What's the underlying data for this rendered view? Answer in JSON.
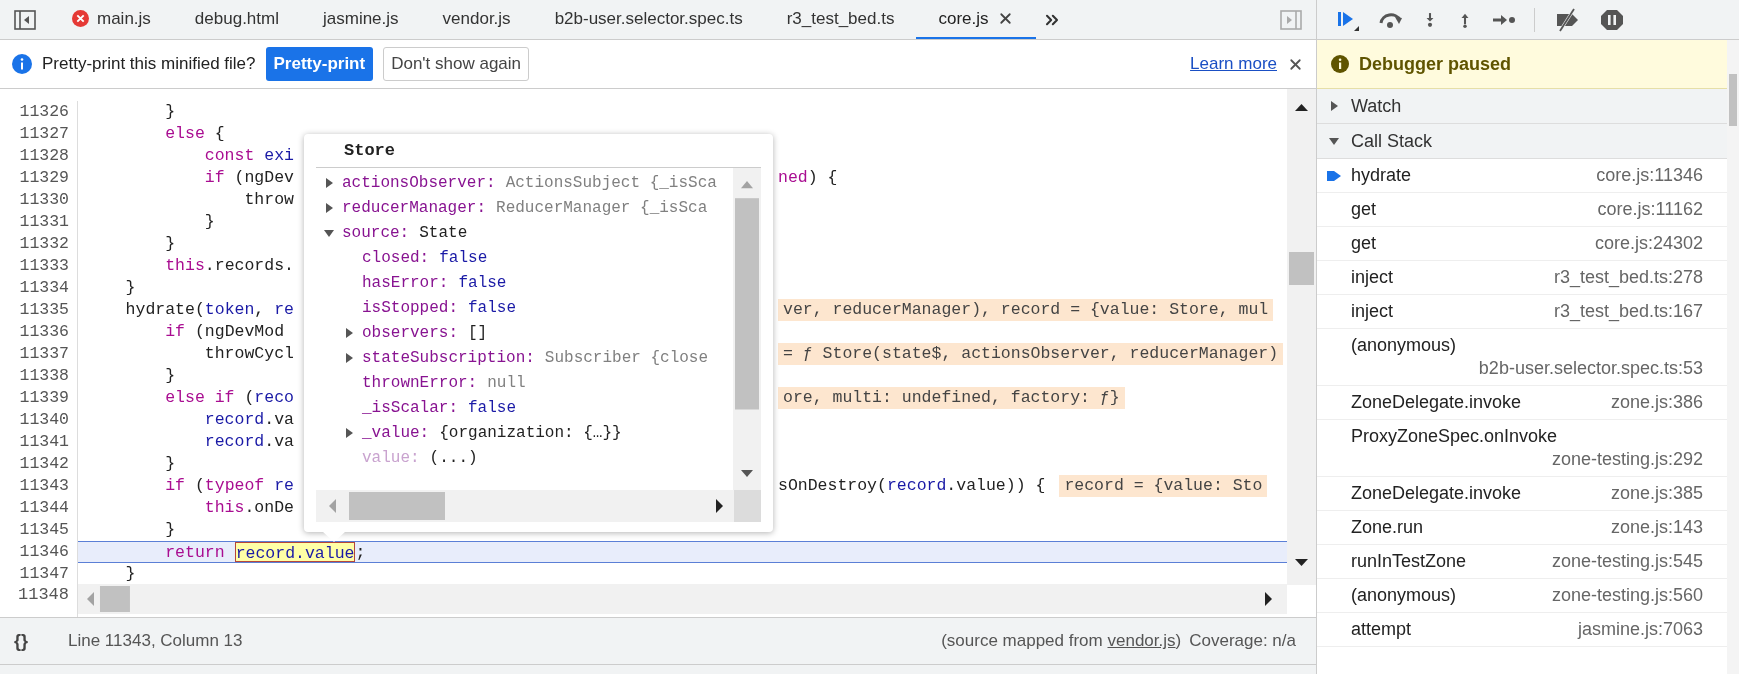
{
  "tabs": [
    {
      "label": "main.js",
      "selected": false,
      "error": true
    },
    {
      "label": "debug.html",
      "selected": false,
      "error": false
    },
    {
      "label": "jasmine.js",
      "selected": false,
      "error": false
    },
    {
      "label": "vendor.js",
      "selected": false,
      "error": false
    },
    {
      "label": "b2b-user.selector.spec.ts",
      "selected": false,
      "error": false
    },
    {
      "label": "r3_test_bed.ts",
      "selected": false,
      "error": false
    },
    {
      "label": "core.js",
      "selected": true,
      "error": false
    }
  ],
  "infobar": {
    "message": "Pretty-print this minified file?",
    "primary_button": "Pretty-print",
    "secondary_button": "Don't show again",
    "link": "Learn more"
  },
  "code": {
    "lines": [
      {
        "number": "11326",
        "current": false,
        "left": [
          {
            "kind": "plain",
            "text": "        }"
          }
        ]
      },
      {
        "number": "11327",
        "current": false,
        "left": [
          {
            "kind": "keyword",
            "text": "        else"
          },
          {
            "kind": "plain",
            "text": " {"
          }
        ]
      },
      {
        "number": "11328",
        "current": false,
        "left": [
          {
            "kind": "keyword",
            "text": "            const"
          },
          {
            "kind": "variable",
            "text": " exi"
          }
        ]
      },
      {
        "number": "11329",
        "current": false,
        "left": [
          {
            "kind": "keyword",
            "text": "            if"
          },
          {
            "kind": "plain",
            "text": " (ngDev"
          }
        ],
        "right": [
          {
            "kind": "keyword",
            "text": "ned"
          },
          {
            "kind": "plain",
            "text": ") {"
          }
        ]
      },
      {
        "number": "11330",
        "current": false,
        "left": [
          {
            "kind": "plain",
            "text": "                throw"
          }
        ]
      },
      {
        "number": "11331",
        "current": false,
        "left": [
          {
            "kind": "plain",
            "text": "            }"
          }
        ]
      },
      {
        "number": "11332",
        "current": false,
        "left": [
          {
            "kind": "plain",
            "text": "        }"
          }
        ]
      },
      {
        "number": "11333",
        "current": false,
        "left": [
          {
            "kind": "keyword",
            "text": "        this"
          },
          {
            "kind": "plain",
            "text": ".records."
          }
        ]
      },
      {
        "number": "11334",
        "current": false,
        "left": [
          {
            "kind": "plain",
            "text": "    }"
          }
        ]
      },
      {
        "number": "11335",
        "current": false,
        "left": [
          {
            "kind": "plain",
            "text": "    hydrate("
          },
          {
            "kind": "variable",
            "text": "token"
          },
          {
            "kind": "plain",
            "text": ", "
          },
          {
            "kind": "variable",
            "text": "re"
          }
        ],
        "right": [
          {
            "kind": "annotation",
            "text": "ver, reducerManager), record = {value: Store, mul"
          }
        ]
      },
      {
        "number": "11336",
        "current": false,
        "left": [
          {
            "kind": "keyword",
            "text": "        if"
          },
          {
            "kind": "plain",
            "text": " (ngDevMod"
          }
        ]
      },
      {
        "number": "11337",
        "current": false,
        "left": [
          {
            "kind": "plain",
            "text": "            throwCycl"
          }
        ],
        "right": [
          {
            "kind": "annotation",
            "text": "= ƒ Store(state$, actionsObserver, reducerManager)"
          }
        ]
      },
      {
        "number": "11338",
        "current": false,
        "left": [
          {
            "kind": "plain",
            "text": "        }"
          }
        ]
      },
      {
        "number": "11339",
        "current": false,
        "left": [
          {
            "kind": "keyword",
            "text": "        else if"
          },
          {
            "kind": "plain",
            "text": " ("
          },
          {
            "kind": "variable",
            "text": "reco"
          }
        ],
        "right": [
          {
            "kind": "annotation",
            "text": "ore, multi: undefined, factory: ƒ}"
          }
        ]
      },
      {
        "number": "11340",
        "current": false,
        "left": [
          {
            "kind": "variable",
            "text": "            record"
          },
          {
            "kind": "plain",
            "text": ".va"
          }
        ]
      },
      {
        "number": "11341",
        "current": false,
        "left": [
          {
            "kind": "variable",
            "text": "            record"
          },
          {
            "kind": "plain",
            "text": ".va"
          }
        ]
      },
      {
        "number": "11342",
        "current": false,
        "left": [
          {
            "kind": "plain",
            "text": "        }"
          }
        ]
      },
      {
        "number": "11343",
        "current": false,
        "left": [
          {
            "kind": "keyword",
            "text": "        if"
          },
          {
            "kind": "plain",
            "text": " ("
          },
          {
            "kind": "keyword",
            "text": "typeof"
          },
          {
            "kind": "variable",
            "text": " re"
          }
        ],
        "right": [
          {
            "kind": "plain",
            "text": "sOnDestroy("
          },
          {
            "kind": "variable",
            "text": "record"
          },
          {
            "kind": "plain",
            "text": ".value)) {"
          },
          {
            "kind": "annotation",
            "text": "record = {value: Sto"
          }
        ]
      },
      {
        "number": "11344",
        "current": false,
        "left": [
          {
            "kind": "keyword",
            "text": "            this"
          },
          {
            "kind": "plain",
            "text": ".onDe"
          }
        ]
      },
      {
        "number": "11345",
        "current": false,
        "left": [
          {
            "kind": "plain",
            "text": "        }"
          }
        ]
      },
      {
        "number": "11346",
        "current": true,
        "left": [
          {
            "kind": "keyword",
            "text": "        return"
          },
          {
            "kind": "highlight",
            "text": "record.value"
          },
          {
            "kind": "plain",
            "text": ";"
          }
        ]
      },
      {
        "number": "11347",
        "current": false,
        "left": [
          {
            "kind": "plain",
            "text": "    }"
          }
        ]
      }
    ],
    "last_number": "11348"
  },
  "popover": {
    "title": "Store",
    "properties": [
      {
        "name": "actionsObserver:",
        "value": "ActionsSubject {_isSca",
        "kind": "class",
        "expanded": false,
        "faded": false
      },
      {
        "name": "reducerManager:",
        "value": "ReducerManager {_isSca",
        "kind": "class",
        "expanded": false,
        "faded": false
      },
      {
        "name": "source:",
        "value": "State",
        "kind": "plain",
        "expanded": true,
        "faded": false,
        "children": [
          {
            "name": "closed:",
            "value": "false",
            "kind": "bool",
            "faded": false
          },
          {
            "name": "hasError:",
            "value": "false",
            "kind": "bool",
            "faded": false
          },
          {
            "name": "isStopped:",
            "value": "false",
            "kind": "bool",
            "faded": false
          },
          {
            "name": "observers:",
            "value": "[]",
            "kind": "plain",
            "expanded": false,
            "faded": false
          },
          {
            "name": "stateSubscription:",
            "value": "Subscriber {close",
            "kind": "class",
            "expanded": false,
            "faded": false
          },
          {
            "name": "thrownError:",
            "value": "null",
            "kind": "null",
            "faded": false
          },
          {
            "name": "_isScalar:",
            "value": "false",
            "kind": "bool",
            "faded": false
          },
          {
            "name": "_value:",
            "value": "{organization: {…}}",
            "kind": "plain",
            "expanded": false,
            "faded": false
          },
          {
            "name": "value:",
            "value": "(...)",
            "kind": "plain",
            "faded": true
          }
        ]
      }
    ]
  },
  "status_bar": {
    "format_button": "{}",
    "position": "Line 11343, Column 13",
    "source_prefix": "(source mapped from",
    "source_link": "vendor.js",
    "source_suffix": ")",
    "coverage": "Coverage: n/a"
  },
  "debugger": {
    "banner": "Debugger paused",
    "sections": [
      {
        "title": "Watch",
        "expanded": false
      },
      {
        "title": "Call Stack",
        "expanded": true
      }
    ],
    "call_stack": [
      {
        "name": "hydrate",
        "location": "core.js:11346",
        "selected": true
      },
      {
        "name": "get",
        "location": "core.js:11162",
        "selected": false
      },
      {
        "name": "get",
        "location": "core.js:24302",
        "selected": false
      },
      {
        "name": "inject",
        "location": "r3_test_bed.ts:278",
        "selected": false
      },
      {
        "name": "inject",
        "location": "r3_test_bed.ts:167",
        "selected": false
      },
      {
        "name": "(anonymous)",
        "location": "b2b-user.selector.spec.ts:53",
        "selected": false
      },
      {
        "name": "ZoneDelegate.invoke",
        "location": "zone.js:386",
        "selected": false
      },
      {
        "name": "ProxyZoneSpec.onInvoke",
        "location": "zone-testing.js:292",
        "selected": false
      },
      {
        "name": "ZoneDelegate.invoke",
        "location": "zone.js:385",
        "selected": false
      },
      {
        "name": "Zone.run",
        "location": "zone.js:143",
        "selected": false
      },
      {
        "name": "runInTestZone",
        "location": "zone-testing.js:545",
        "selected": false
      },
      {
        "name": "(anonymous)",
        "location": "zone-testing.js:560",
        "selected": false
      },
      {
        "name": "attempt",
        "location": "jasmine.js:7063",
        "selected": false
      }
    ]
  }
}
